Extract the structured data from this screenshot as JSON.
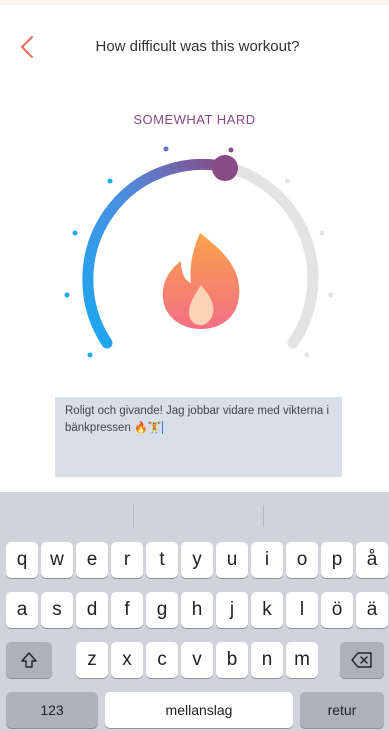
{
  "header": {
    "title": "How difficult was this workout?",
    "accent_color": "#f06b5a"
  },
  "difficulty": {
    "label": "SOMEWHAT HARD",
    "label_color": "#8a4a86",
    "level_fraction": 0.5,
    "icon": "flame-icon"
  },
  "note": {
    "text": "Roligt och givande! Jag jobbar vidare med vikterna i bänkpressen",
    "emojis": "🔥🏋"
  },
  "keyboard": {
    "row1": [
      "q",
      "w",
      "e",
      "r",
      "t",
      "y",
      "u",
      "i",
      "o",
      "p",
      "å"
    ],
    "row2": [
      "a",
      "s",
      "d",
      "f",
      "g",
      "h",
      "j",
      "k",
      "l",
      "ö",
      "ä"
    ],
    "row3": [
      "z",
      "x",
      "c",
      "v",
      "b",
      "n",
      "m"
    ],
    "shift_icon": "shift-icon",
    "backspace_icon": "backspace-icon",
    "numbers_label": "123",
    "space_label": "mellanslag",
    "return_label": "retur"
  }
}
